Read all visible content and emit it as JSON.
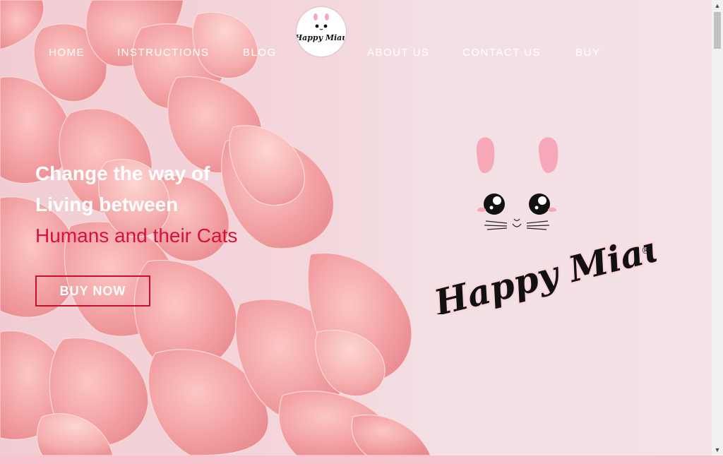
{
  "nav": {
    "items": [
      {
        "label": "HOME"
      },
      {
        "label": "INSTRUCTIONS"
      },
      {
        "label": "BLOG"
      },
      {
        "label": "ABOUT US"
      },
      {
        "label": "CONTACT US"
      },
      {
        "label": "BUY"
      }
    ],
    "logo_text": "Happy Miau"
  },
  "hero": {
    "line1": "Change the way of",
    "line2": "Living between",
    "line3": "Humans and their Cats",
    "cta_label": "BUY NOW"
  },
  "brand": {
    "name": "Happy Miau",
    "registered_mark": "®"
  },
  "colors": {
    "accent": "#d8103c",
    "background": "#f3dde3",
    "petal": "#f4a3a8"
  }
}
